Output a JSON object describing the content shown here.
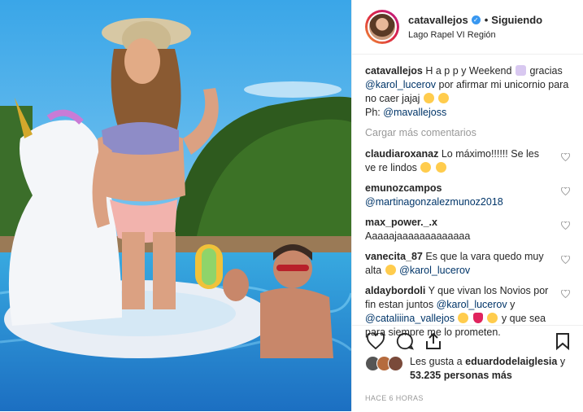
{
  "post": {
    "username": "catavallejos",
    "follow_status": "Siguiendo",
    "dot": "•",
    "location": "Lago Rapel VI Región",
    "verified_glyph": "✓",
    "photo_icon": "unicorn-float-photo"
  },
  "caption": {
    "username": "catavallejos",
    "text_1": "H a p p y Weekend",
    "text_2": "gracias",
    "mention_1": "@karol_lucerov",
    "text_3": "por afirmar mi unicornio para no caer jajaj",
    "text_4": "Ph:",
    "mention_2": "@mavallejoss"
  },
  "load_more": "Cargar más comentarios",
  "comments": [
    {
      "user": "claudiaroxanaz",
      "text": "Lo máximo!!!!!! Se les ve re lindos"
    },
    {
      "user": "emunozcampos",
      "mention": "@martinagonzalezmunoz2018"
    },
    {
      "user": "max_power._.x",
      "text": "Aaaaajaaaaaaaaaaaaa"
    },
    {
      "user": "vanecita_87",
      "text": "Es que la vara quedo muy alta",
      "mention": "@karol_lucerov"
    },
    {
      "user": "aldaybordoli",
      "text_1": "Y que vivan los Novios por fin estan juntos",
      "mention_1": "@karol_lucerov",
      "text_2": "y",
      "mention_2": "@cataliiina_vallejos",
      "text_3": "y que sea para siempre me lo prometen."
    }
  ],
  "likes": {
    "prefix": "Les gusta a",
    "user": "eduardodelaiglesia",
    "connector": "y",
    "count": "53.235 personas más"
  },
  "time": "HACE 6 HORAS",
  "colors": {
    "accent": "#3897f0",
    "link": "#003569",
    "muted": "#999999"
  }
}
